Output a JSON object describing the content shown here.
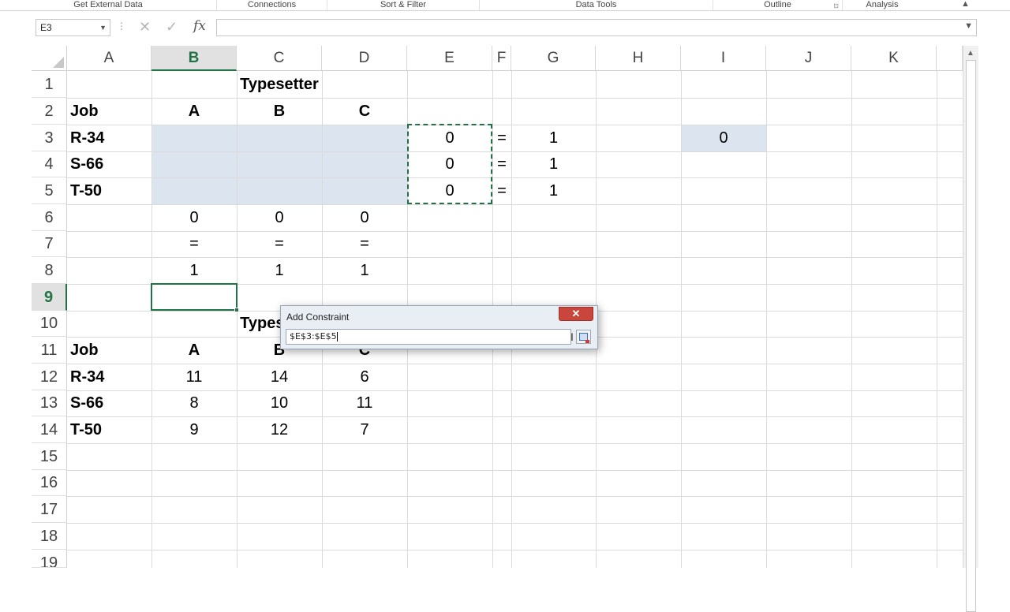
{
  "ribbon": {
    "groups": [
      {
        "label": "Get External Data"
      },
      {
        "label": "Connections"
      },
      {
        "label": "Sort & Filter"
      },
      {
        "label": "Data Tools"
      },
      {
        "label": "Outline"
      },
      {
        "label": "Analysis"
      }
    ],
    "collapse_glyph": "▲",
    "launcher_glyph": "⊡"
  },
  "formula_bar": {
    "name_box": "E3",
    "dropdown_glyph": "▼",
    "dots": "⋮",
    "cancel_glyph": "✕",
    "enter_glyph": "✓",
    "fx_label": "fx",
    "formula": "",
    "expand_glyph": "▼"
  },
  "grid": {
    "columns": [
      "A",
      "B",
      "C",
      "D",
      "E",
      "F",
      "G",
      "H",
      "I",
      "J",
      "K"
    ],
    "active_column": "B",
    "rows": [
      "1",
      "2",
      "3",
      "4",
      "5",
      "6",
      "7",
      "8",
      "9",
      "10",
      "11",
      "12",
      "13",
      "14",
      "15",
      "16",
      "17",
      "18",
      "19"
    ],
    "active_row": "9",
    "cells": {
      "title1": "Typesetter",
      "job1": "Job",
      "hdr_a1": "A",
      "hdr_b1": "B",
      "hdr_c1": "C",
      "r34a": "R-34",
      "s66a": "S-66",
      "t50a": "T-50",
      "e3": "0",
      "e4": "0",
      "e5": "0",
      "f3": "=",
      "f4": "=",
      "f5": "=",
      "g3": "1",
      "g4": "1",
      "g5": "1",
      "i3": "0",
      "b6": "0",
      "c6": "0",
      "d6": "0",
      "b7": "=",
      "c7": "=",
      "d7": "=",
      "b8": "1",
      "c8": "1",
      "d8": "1",
      "title2": "Typesetter",
      "job2": "Job",
      "hdr_a2": "A",
      "hdr_b2": "B",
      "hdr_c2": "C",
      "r34b": "R-34",
      "s66b": "S-66",
      "t50b": "T-50",
      "b12": "11",
      "c12": "14",
      "d12": "6",
      "b13": "8",
      "c13": "10",
      "d13": "11",
      "b14": "9",
      "c14": "12",
      "d14": "7"
    }
  },
  "dialog": {
    "title": "Add Constraint",
    "close_glyph": "✕",
    "reference": "$E$3:$E$5",
    "ibeam_glyph": "I"
  },
  "scrollbar": {
    "up_glyph": "▲"
  },
  "colors": {
    "accent": "#217346",
    "selection_shade": "#dce4f0",
    "dialog_close": "#c9463d"
  }
}
